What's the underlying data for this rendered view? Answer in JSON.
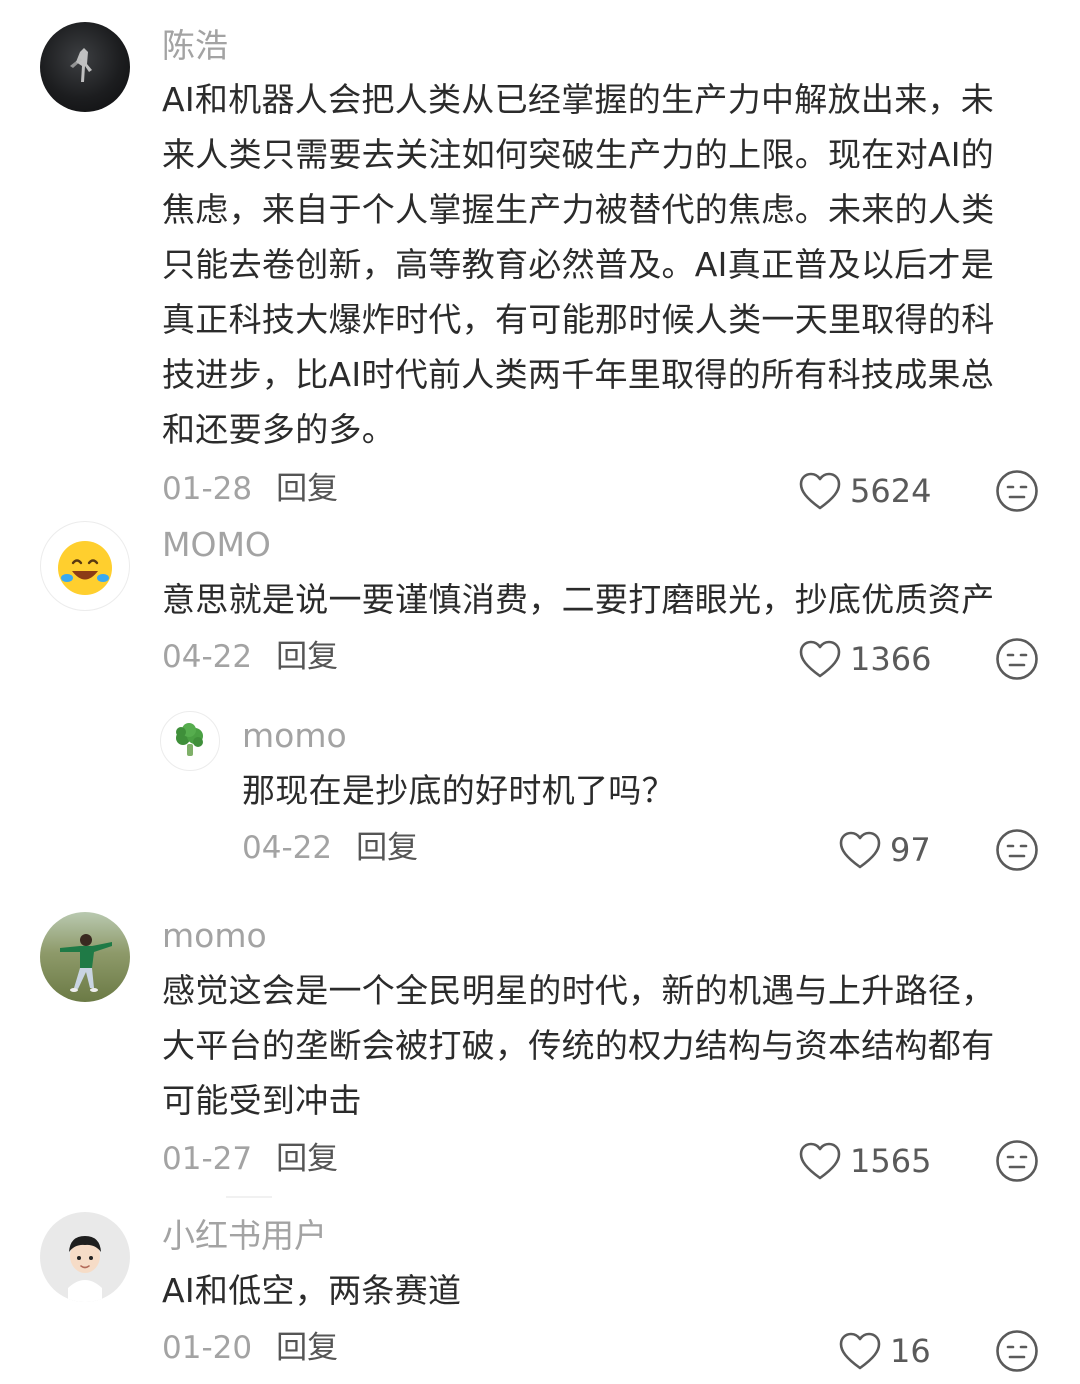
{
  "comments": [
    {
      "username": "陈浩",
      "lines": [
        "AI和机器人会把人类从已经掌握的生产力中解放出来，未",
        "来人类只需要去关注如何突破生产力的上限。现在对AI的",
        "焦虑，来自于个人掌握生产力被替代的焦虑。未来的人类",
        "只能去卷创新，高等教育必然普及。AI真正普及以后才是",
        "真正科技大爆炸时代，有可能那时候人类一天里取得的科",
        "技进步，比AI时代前人类两千年里取得的所有科技成果总",
        "和还要多的多。"
      ],
      "date": "01-28",
      "reply_label": "回复",
      "likes": "5624",
      "avatar_icon": "dark-figure-avatar"
    },
    {
      "username": "MOMO",
      "lines": [
        "意思就是说一要谨慎消费，二要打磨眼光，抄底优质资产"
      ],
      "date": "04-22",
      "reply_label": "回复",
      "likes": "1366",
      "avatar_icon": "laughing-emoji-avatar"
    },
    {
      "username": "momo",
      "lines": [
        "那现在是抄底的好时机了吗？"
      ],
      "date": "04-22",
      "reply_label": "回复",
      "likes": "97",
      "avatar_icon": "broccoli-avatar"
    },
    {
      "username": "momo",
      "lines": [
        "感觉这会是一个全民明星的时代，新的机遇与上升路径，",
        "大平台的垄断会被打破，传统的权力结构与资本结构都有",
        "可能受到冲击"
      ],
      "date": "01-27",
      "reply_label": "回复",
      "likes": "1565",
      "avatar_icon": "girl-grassland-avatar"
    },
    {
      "username": "小红书用户",
      "lines": [
        "AI和低空，两条赛道"
      ],
      "date": "01-20",
      "reply_label": "回复",
      "likes": "16",
      "avatar_icon": "cartoon-boy-avatar"
    }
  ],
  "colors": {
    "username": "#a3a3a3",
    "text": "#2b2b2b",
    "icon": "#5a5a5a"
  }
}
